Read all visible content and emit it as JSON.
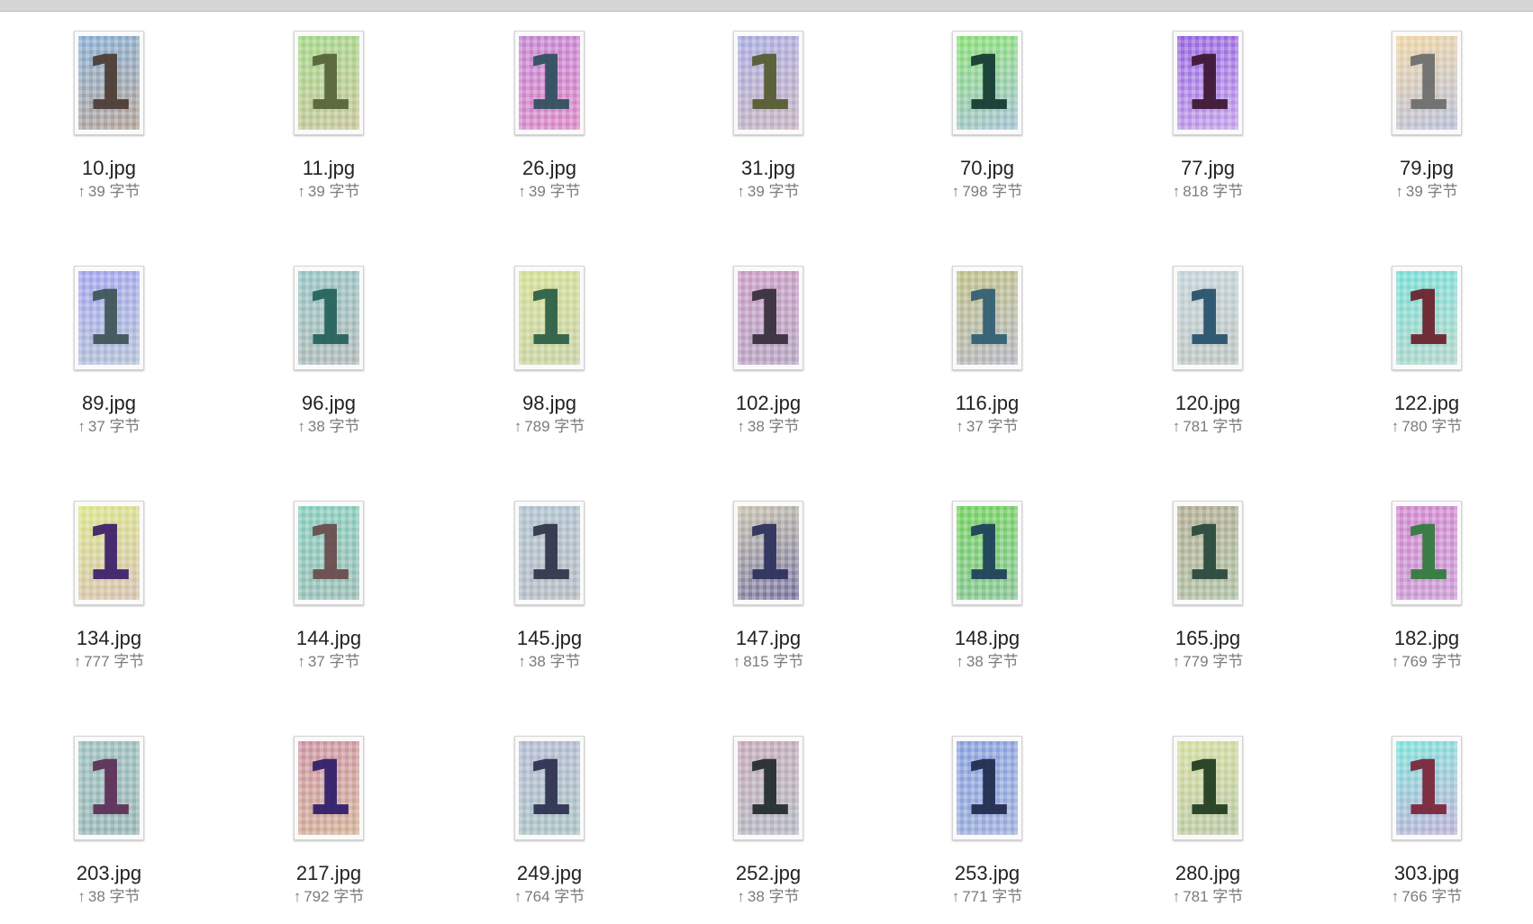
{
  "files": [
    {
      "name": "10.jpg",
      "size": "39 字节",
      "glyph": "1",
      "bg1": "#8fb3d6",
      "bg2": "#b6a69a",
      "fg": "#4a3b33"
    },
    {
      "name": "11.jpg",
      "size": "39 字节",
      "glyph": "1",
      "bg1": "#a9d88e",
      "bg2": "#c8c79f",
      "fg": "#556236"
    },
    {
      "name": "26.jpg",
      "size": "39 字节",
      "glyph": "1",
      "bg1": "#c78dd5",
      "bg2": "#dc8fc8",
      "fg": "#2d4f5c"
    },
    {
      "name": "31.jpg",
      "size": "39 字节",
      "glyph": "1",
      "bg1": "#aeb0e2",
      "bg2": "#c8b6c2",
      "fg": "#535a2d"
    },
    {
      "name": "70.jpg",
      "size": "798 字节",
      "glyph": "1",
      "bg1": "#8ee07b",
      "bg2": "#a8c3d5",
      "fg": "#12382f"
    },
    {
      "name": "77.jpg",
      "size": "818 字节",
      "glyph": "1",
      "bg1": "#9b6ee0",
      "bg2": "#c7a8ea",
      "fg": "#3a1530"
    },
    {
      "name": "79.jpg",
      "size": "39 字节",
      "glyph": "1",
      "bg1": "#f0d7a9",
      "bg2": "#b9c0d9",
      "fg": "#6b6d6b"
    },
    {
      "name": "89.jpg",
      "size": "37 字节",
      "glyph": "1",
      "bg1": "#a8a9ee",
      "bg2": "#b7c4d6",
      "fg": "#3d5456"
    },
    {
      "name": "96.jpg",
      "size": "38 字节",
      "glyph": "1",
      "bg1": "#9cc7c6",
      "bg2": "#b4bbbb",
      "fg": "#23605a"
    },
    {
      "name": "98.jpg",
      "size": "789 字节",
      "glyph": "1",
      "bg1": "#d6e09a",
      "bg2": "#c9d3a8",
      "fg": "#2a5d44"
    },
    {
      "name": "102.jpg",
      "size": "38 字节",
      "glyph": "1",
      "bg1": "#cda3c7",
      "bg2": "#b8a8c4",
      "fg": "#352d3a"
    },
    {
      "name": "116.jpg",
      "size": "37 字节",
      "glyph": "1",
      "bg1": "#c2c48e",
      "bg2": "#b7b9c2",
      "fg": "#2f5d73"
    },
    {
      "name": "120.jpg",
      "size": "781 字节",
      "glyph": "1",
      "bg1": "#c8d6dc",
      "bg2": "#bec7c2",
      "fg": "#24506a"
    },
    {
      "name": "122.jpg",
      "size": "780 字节",
      "glyph": "1",
      "bg1": "#7fe0d8",
      "bg2": "#b6d6cc",
      "fg": "#6b1e2a"
    },
    {
      "name": "134.jpg",
      "size": "777 字节",
      "glyph": "1",
      "bg1": "#dbe691",
      "bg2": "#d7c2b2",
      "fg": "#3b1d6a"
    },
    {
      "name": "144.jpg",
      "size": "37 字节",
      "glyph": "1",
      "bg1": "#8ed0bf",
      "bg2": "#9fbfb8",
      "fg": "#6a4a4b"
    },
    {
      "name": "145.jpg",
      "size": "38 字节",
      "glyph": "1",
      "bg1": "#b3c6d1",
      "bg2": "#b9bdc5",
      "fg": "#2e3348"
    },
    {
      "name": "147.jpg",
      "size": "815 字节",
      "glyph": "1",
      "bg1": "#c9c6b3",
      "bg2": "#7d7aa2",
      "fg": "#2b2f5b"
    },
    {
      "name": "148.jpg",
      "size": "38 字节",
      "glyph": "1",
      "bg1": "#7cd46b",
      "bg2": "#8ec79b",
      "fg": "#1c3e58"
    },
    {
      "name": "165.jpg",
      "size": "779 字节",
      "glyph": "1",
      "bg1": "#b5b198",
      "bg2": "#b3c4aa",
      "fg": "#27463a"
    },
    {
      "name": "182.jpg",
      "size": "769 字节",
      "glyph": "1",
      "bg1": "#d38fd0",
      "bg2": "#cba2d6",
      "fg": "#2f7a3b"
    },
    {
      "name": "203.jpg",
      "size": "38 字节",
      "glyph": "1",
      "bg1": "#a3c4c1",
      "bg2": "#9cb8b8",
      "fg": "#5c2d56"
    },
    {
      "name": "217.jpg",
      "size": "792 字节",
      "glyph": "1",
      "bg1": "#cf9aa8",
      "bg2": "#d3b59d",
      "fg": "#2c1c6a"
    },
    {
      "name": "249.jpg",
      "size": "764 字节",
      "glyph": "1",
      "bg1": "#b8bed6",
      "bg2": "#adc5c4",
      "fg": "#2b2f4e"
    },
    {
      "name": "252.jpg",
      "size": "38 字节",
      "glyph": "1",
      "bg1": "#c8aebd",
      "bg2": "#b7bcc4",
      "fg": "#222a2a"
    },
    {
      "name": "253.jpg",
      "size": "771 字节",
      "glyph": "1",
      "bg1": "#8fa6e0",
      "bg2": "#a3b3db",
      "fg": "#1f2a4b"
    },
    {
      "name": "280.jpg",
      "size": "781 字节",
      "glyph": "1",
      "bg1": "#d6e0a5",
      "bg2": "#bcc8a8",
      "fg": "#1e3a1f"
    },
    {
      "name": "303.jpg",
      "size": "766 字节",
      "glyph": "1",
      "bg1": "#87e3dd",
      "bg2": "#c0b3d6",
      "fg": "#7a2236"
    }
  ],
  "upload_arrow": "↑"
}
